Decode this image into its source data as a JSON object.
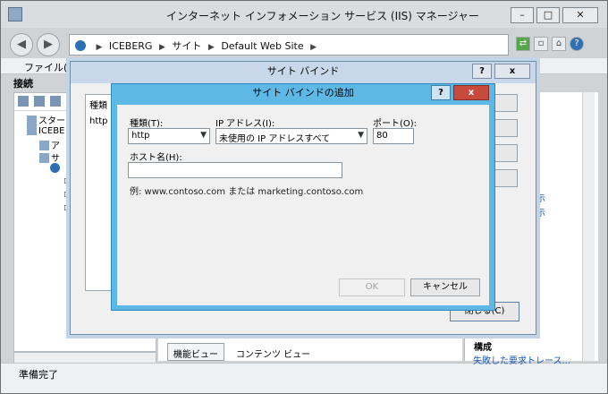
{
  "window": {
    "title": "インターネット インフォメーション サービス (IIS) マネージャー",
    "minimize": "–",
    "maximize": "□",
    "close": "✕"
  },
  "address": {
    "crumbs": [
      "ICEBERG",
      "サイト",
      "Default Web Site"
    ],
    "sep": "▶",
    "back": "◀",
    "forward": "▶"
  },
  "menu": {
    "file": "ファイル(E)"
  },
  "connections": {
    "header": "接続",
    "tree": [
      "スタート",
      "ICEBE",
      "ア",
      "サ"
    ]
  },
  "bottom_tabs": {
    "features": "機能ビュー",
    "content": "コンテンツ ビュー"
  },
  "actions": {
    "link1": "示",
    "link2": "示",
    "section_header": "構成",
    "failed_trace": "失敗した要求トレース..."
  },
  "status": {
    "text": "準備完了"
  },
  "bindings_dialog": {
    "title": "サイト バインド",
    "help": "?",
    "close": "x",
    "column_type": "種類",
    "row_type": "http",
    "close_button": "閉じる(C)"
  },
  "add_dialog": {
    "title": "サイト バインドの追加",
    "help": "?",
    "close": "x",
    "type_label": "種類(T):",
    "type_value": "http",
    "ip_label": "IP アドレス(I):",
    "ip_value": "未使用の IP アドレスすべて",
    "port_label": "ポート(O):",
    "port_value": "80",
    "host_label": "ホスト名(H):",
    "host_value": "",
    "example": "例: www.contoso.com または marketing.contoso.com",
    "ok": "OK",
    "cancel": "キャンセル"
  }
}
